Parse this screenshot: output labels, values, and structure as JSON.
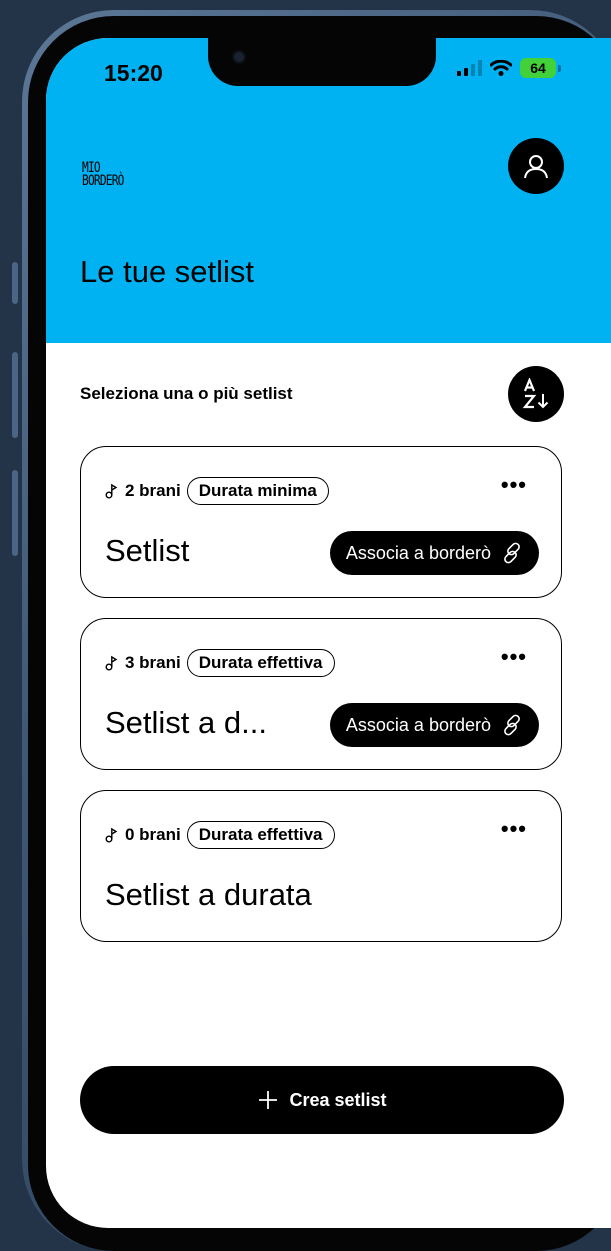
{
  "status_bar": {
    "time": "15:20",
    "battery": "64"
  },
  "header": {
    "logo_line1": "MIO",
    "logo_line2": "BORDERÒ",
    "title": "Le tue setlist"
  },
  "main": {
    "subtitle": "Seleziona una o più setlist",
    "sort_icon": "sort-az-icon",
    "setlists": [
      {
        "count": "2 brani",
        "tag": "Durata minima",
        "name": "Setlist",
        "action": "Associa a borderò"
      },
      {
        "count": "3 brani",
        "tag": "Durata effettiva",
        "name": "Setlist a d...",
        "action": "Associa a borderò"
      },
      {
        "count": "0 brani",
        "tag": "Durata effettiva",
        "name": "Setlist a durata"
      }
    ],
    "create_label": "Crea setlist"
  },
  "colors": {
    "header_bg": "#00b2f1",
    "accent": "#000000",
    "background": "#ffffff"
  }
}
